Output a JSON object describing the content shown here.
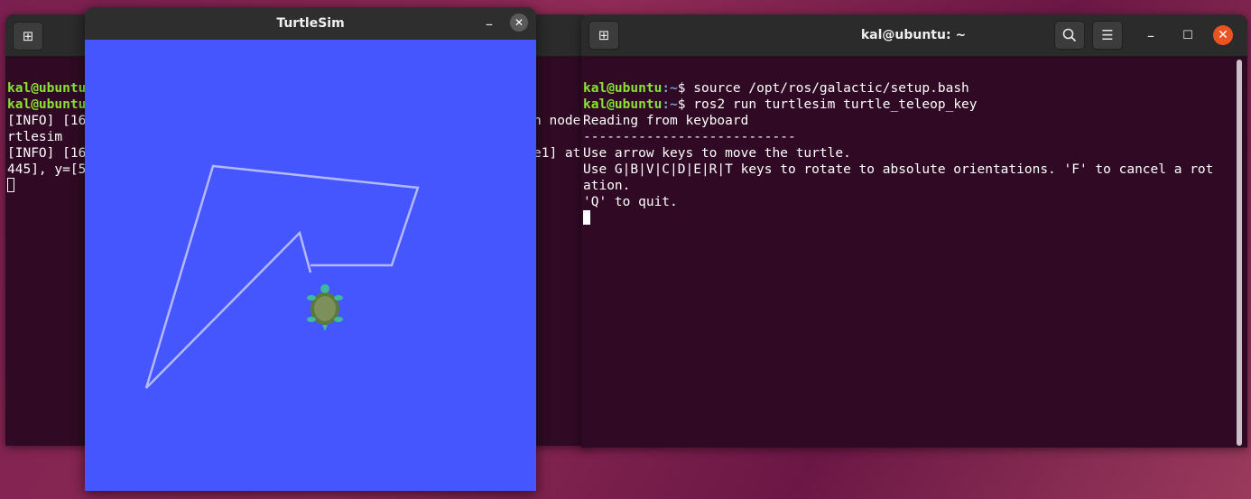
{
  "left_terminal": {
    "lines": [
      {
        "user": "kal@ubuntu",
        "rest": ""
      },
      {
        "user": "kal@ubuntu",
        "rest": ""
      },
      {
        "text": "[INFO] [16",
        "tail": "h node"
      },
      {
        "text": "rtlesim",
        "tail": ""
      },
      {
        "text": "[INFO] [16",
        "tail": "e1] at"
      },
      {
        "text": "445], y=[5",
        "tail": ""
      }
    ]
  },
  "turtlesim": {
    "title": "TurtleSim",
    "minimize": "–",
    "close": "✕",
    "colors": {
      "background": "#4556ff",
      "pen": "#b3b8ff"
    }
  },
  "right_terminal": {
    "title": "kal@ubuntu: ~",
    "minimize": "–",
    "maximize": "☐",
    "close": "✕",
    "prompt_user": "kal@ubuntu",
    "prompt_path": ":~",
    "prompt_sym": "$ ",
    "cmd1": "source /opt/ros/galactic/setup.bash",
    "cmd2": "ros2 run turtlesim turtle_teleop_key",
    "out": [
      "Reading from keyboard",
      "---------------------------",
      "Use arrow keys to move the turtle.",
      "Use G|B|V|C|D|E|R|T keys to rotate to absolute orientations. 'F' to cancel a rot",
      "ation.",
      "'Q' to quit."
    ]
  }
}
